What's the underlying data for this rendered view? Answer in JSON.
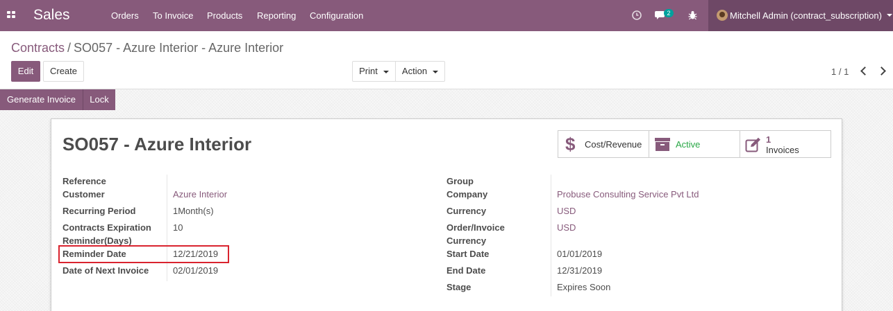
{
  "navbar": {
    "app_name": "Sales",
    "menu": [
      "Orders",
      "To Invoice",
      "Products",
      "Reporting",
      "Configuration"
    ],
    "messages_count": "2",
    "user_name": "Mitchell Admin (contract_subscription)",
    "icons": [
      "apps-icon",
      "clock-icon",
      "chat-icon",
      "bug-icon"
    ]
  },
  "breadcrumb": {
    "parent": "Contracts",
    "separator": "/",
    "current": "SO057 - Azure Interior - Azure Interior"
  },
  "toolbar": {
    "edit": "Edit",
    "create": "Create",
    "print": "Print",
    "action": "Action"
  },
  "pager": {
    "value": "1 / 1"
  },
  "statusbar": {
    "generate_invoice": "Generate Invoice",
    "lock": "Lock"
  },
  "record": {
    "title": "SO057 - Azure Interior"
  },
  "smart_buttons": {
    "cost_revenue": "Cost/Revenue",
    "active": "Active",
    "invoices_count": "1",
    "invoices_label": "Invoices"
  },
  "fields_left": {
    "reference": {
      "label": "Reference",
      "value": ""
    },
    "customer": {
      "label": "Customer",
      "value": "Azure Interior"
    },
    "recurring_period": {
      "label": "Recurring Period",
      "value": "1Month(s)"
    },
    "expiration_reminder": {
      "label_line1": "Contracts Expiration",
      "label_line2": "Reminder(Days)",
      "value": "10"
    },
    "reminder_date": {
      "label": "Reminder Date",
      "value": "12/21/2019"
    },
    "next_invoice": {
      "label": "Date of Next Invoice",
      "value": "02/01/2019"
    }
  },
  "fields_right": {
    "group": {
      "label": "Group",
      "value": ""
    },
    "company": {
      "label": "Company",
      "value": "Probuse Consulting Service Pvt Ltd"
    },
    "currency": {
      "label": "Currency",
      "value": "USD"
    },
    "order_currency": {
      "label_line1": "Order/Invoice",
      "label_line2": "Currency",
      "value": "USD"
    },
    "start_date": {
      "label": "Start Date",
      "value": "01/01/2019"
    },
    "end_date": {
      "label": "End Date",
      "value": "12/31/2019"
    },
    "stage": {
      "label": "Stage",
      "value": "Expires Soon"
    }
  },
  "colors": {
    "brand": "#875a7b",
    "active": "#28a745",
    "highlight": "#d9232e"
  }
}
